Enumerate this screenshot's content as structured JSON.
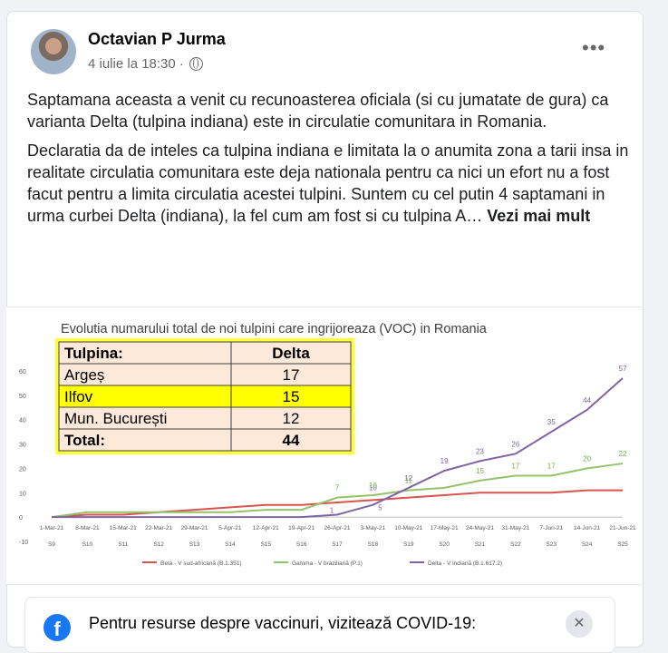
{
  "post": {
    "author": "Octavian P Jurma",
    "date": "4 iulie la 18:30 ·",
    "paragraph1": "Saptamana aceasta a venit cu recunoasterea oficiala (si cu jumatate de gura) ca varianta Delta (tulpina indiana) este in circulatie comunitara in Romania.",
    "paragraph2": "Declaratia da de inteles ca tulpina indiana e limitata la o anumita zona a tarii insa in realitate circulatia comunitara este deja nationala pentru ca nici un efort nu a fost facut pentru a limita circulatia acestei tulpini. Suntem cu cel putin 4 saptamani in urma curbei Delta (indiana), la fel cum am fost si cu tulpina A… ",
    "see_more": "Vezi mai mult",
    "icons": {
      "more": "more-options-icon",
      "privacy": "globe-icon"
    }
  },
  "banner": {
    "text": "Pentru resurse despre vaccinuri, vizitează COVID-19:",
    "icon": "facebook-icon",
    "close": "✕"
  },
  "chart_data": {
    "type": "line",
    "title": "Evolutia numarului total de noi tulpini care ingrijoreaza (VOC) in Romania",
    "x": [
      "1-Mar-21",
      "8-Mar-21",
      "15-Mar-21",
      "22-Mar-21",
      "29-Mar-21",
      "5-Apr-21",
      "12-Apr-21",
      "19-Apr-21",
      "26-Apr-21",
      "3-May-21",
      "10-May-21",
      "17-May-21",
      "24-May-21",
      "31-May-21",
      "7-Jun-21",
      "14-Jun-21",
      "21-Jun-21"
    ],
    "x_secondary": [
      "S9",
      "S10",
      "S11",
      "S12",
      "S13",
      "S14",
      "S15",
      "S16",
      "S17",
      "S18",
      "S19",
      "S20",
      "S21",
      "S22",
      "S23",
      "S24",
      "S25"
    ],
    "ylim": [
      -10,
      60
    ],
    "yticks": [
      -10,
      0,
      10,
      20,
      30,
      40,
      50,
      60
    ],
    "series": [
      {
        "name": "Beta - V sud-africană (B.1.351)",
        "color": "#d9534f",
        "values": [
          0,
          1,
          1,
          2,
          3,
          4,
          5,
          5,
          6,
          7,
          8,
          9,
          10,
          10,
          10,
          11,
          11
        ]
      },
      {
        "name": "Gamma - V braziliană (P.1)",
        "color": "#92c36b",
        "values": [
          0,
          2,
          2,
          2,
          2,
          2,
          3,
          3,
          8,
          9,
          11,
          12,
          15,
          17,
          17,
          20,
          22
        ]
      },
      {
        "name": "Delta - V indiană (B.1.617.2)",
        "color": "#8064a2",
        "values": [
          0,
          0,
          0,
          0,
          0,
          0,
          0,
          0,
          1,
          5,
          12,
          19,
          23,
          26,
          35,
          44,
          57
        ]
      }
    ],
    "data_labels": [
      {
        "series": 2,
        "index": 8,
        "text": "1"
      },
      {
        "series": 2,
        "index": 9,
        "text": "5"
      },
      {
        "series": 2,
        "index": 9,
        "text": "10",
        "offset": "above"
      },
      {
        "series": 2,
        "index": 10,
        "text": "12"
      },
      {
        "series": 2,
        "index": 11,
        "text": "19"
      },
      {
        "series": 2,
        "index": 12,
        "text": "23"
      },
      {
        "series": 2,
        "index": 13,
        "text": "26"
      },
      {
        "series": 2,
        "index": 14,
        "text": "35"
      },
      {
        "series": 2,
        "index": 15,
        "text": "44"
      },
      {
        "series": 2,
        "index": 16,
        "text": "57"
      },
      {
        "series": 1,
        "index": 8,
        "text": "7"
      },
      {
        "series": 1,
        "index": 9,
        "text": "10"
      },
      {
        "series": 1,
        "index": 10,
        "text": "11"
      },
      {
        "series": 1,
        "index": 12,
        "text": "15"
      },
      {
        "series": 1,
        "index": 13,
        "text": "17"
      },
      {
        "series": 1,
        "index": 14,
        "text": "17"
      },
      {
        "series": 1,
        "index": 15,
        "text": "20"
      },
      {
        "series": 1,
        "index": 16,
        "text": "22"
      }
    ],
    "inset_table": {
      "headers": [
        "Tulpina:",
        "Delta"
      ],
      "rows": [
        [
          "Argeș",
          "17"
        ],
        [
          "Ilfov",
          "15"
        ],
        [
          "Mun. București",
          "12"
        ]
      ],
      "total": [
        "Total:",
        "44"
      ]
    },
    "legend_position": "bottom"
  }
}
